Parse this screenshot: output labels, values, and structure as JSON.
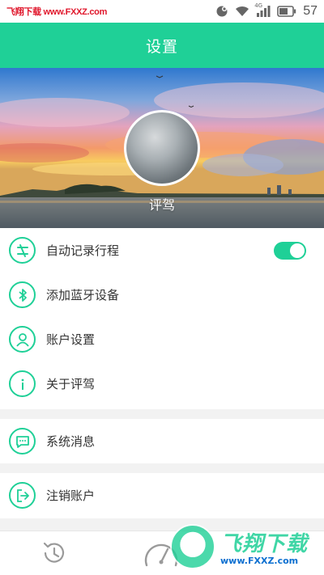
{
  "status_bar": {
    "watermark": "飞翔下载 www.FXXZ.com",
    "network_label": "4G",
    "battery": "57",
    "icons": [
      "notification-icon",
      "wifi-icon",
      "signal-icon",
      "battery-icon"
    ]
  },
  "header": {
    "title": "设置"
  },
  "profile": {
    "name": "评驾"
  },
  "menu": {
    "auto_record": {
      "label": "自动记录行程",
      "icon": "route-icon",
      "enabled": true
    },
    "bluetooth": {
      "label": "添加蓝牙设备",
      "icon": "bluetooth-icon"
    },
    "account": {
      "label": "账户设置",
      "icon": "user-icon"
    },
    "about": {
      "label": "关于评驾",
      "icon": "info-icon"
    },
    "messages": {
      "label": "系统消息",
      "icon": "message-icon"
    },
    "logout": {
      "label": "注销账户",
      "icon": "logout-icon"
    }
  },
  "bottom_nav": {
    "items": [
      {
        "icon": "history-icon"
      },
      {
        "icon": "speedometer-icon"
      }
    ],
    "watermark_cn": "飞翔下载",
    "watermark_url": "www.FXXZ.com"
  },
  "colors": {
    "accent": "#1fd097",
    "header_text": "#ffffff",
    "watermark_red": "#e0162b"
  }
}
